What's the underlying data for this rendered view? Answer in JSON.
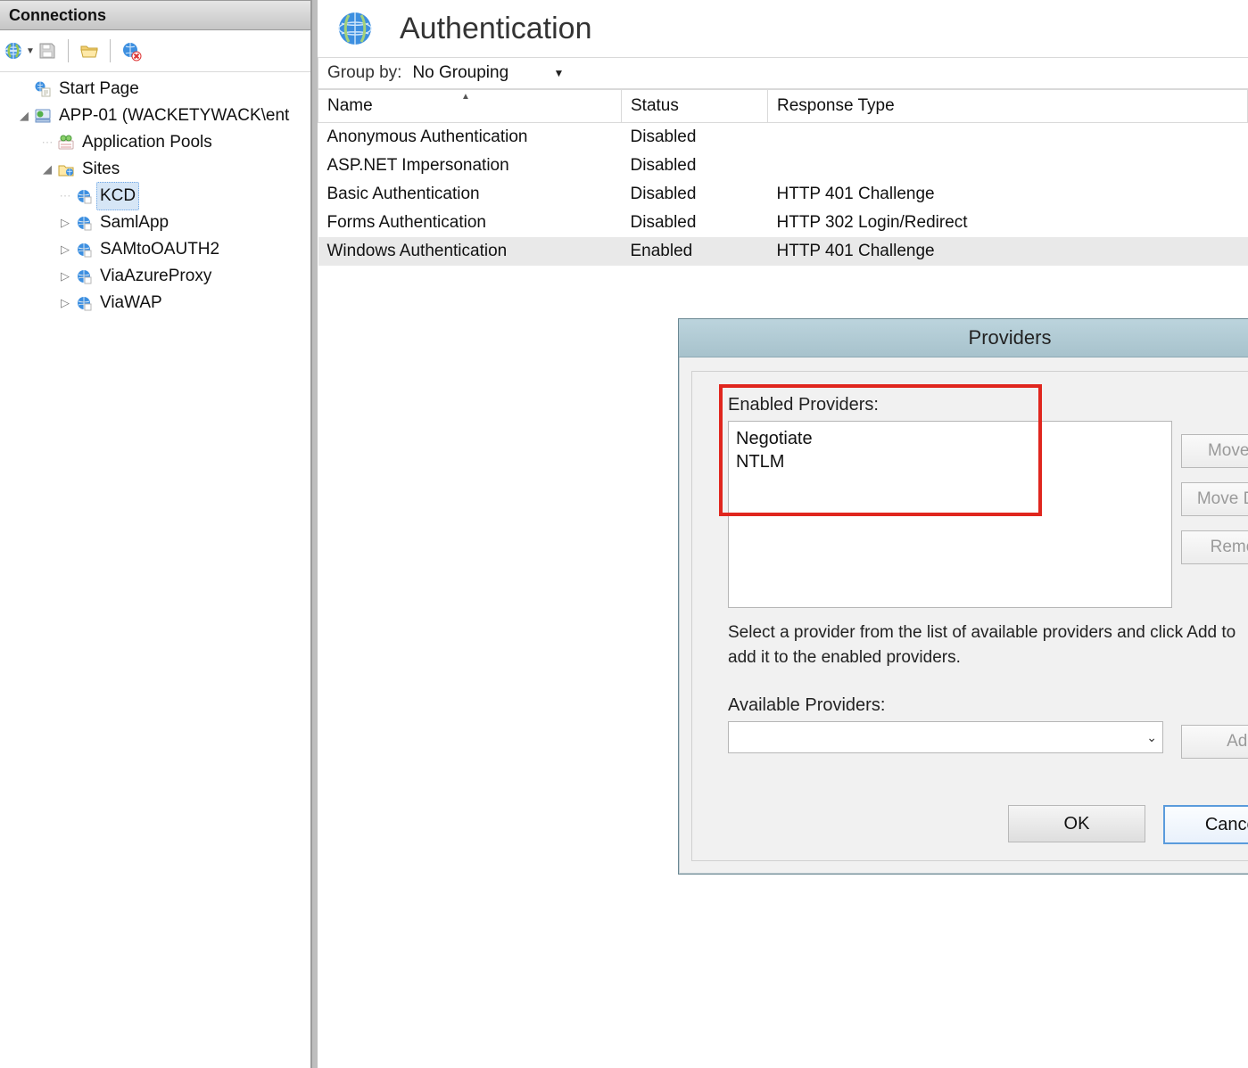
{
  "sidebar": {
    "title": "Connections",
    "tree": {
      "start_page": "Start Page",
      "server": "APP-01 (WACKETYWACK\\ent",
      "app_pools": "Application Pools",
      "sites": "Sites",
      "site_items": [
        "KCD",
        "SamlApp",
        "SAMtoOAUTH2",
        "ViaAzureProxy",
        "ViaWAP"
      ],
      "selected_index": 0
    }
  },
  "page": {
    "title": "Authentication",
    "group_by_label": "Group by:",
    "group_by_value": "No Grouping",
    "columns": [
      "Name",
      "Status",
      "Response Type"
    ],
    "rows": [
      {
        "name": "Anonymous Authentication",
        "status": "Disabled",
        "response": ""
      },
      {
        "name": "ASP.NET Impersonation",
        "status": "Disabled",
        "response": ""
      },
      {
        "name": "Basic Authentication",
        "status": "Disabled",
        "response": "HTTP 401 Challenge"
      },
      {
        "name": "Forms Authentication",
        "status": "Disabled",
        "response": "HTTP 302 Login/Redirect"
      },
      {
        "name": "Windows Authentication",
        "status": "Enabled",
        "response": "HTTP 401 Challenge"
      }
    ],
    "selected_row": 4
  },
  "dialog": {
    "title": "Providers",
    "help_symbol": "?",
    "close_symbol": "x",
    "enabled_label": "Enabled Providers:",
    "enabled": [
      "Negotiate",
      "NTLM"
    ],
    "instruction": "Select a provider from the list of available providers and click Add to add it to the enabled providers.",
    "available_label": "Available Providers:",
    "available_value": "",
    "buttons": {
      "move_up": "Move Up",
      "move_down": "Move Down",
      "remove": "Remove",
      "add": "Add",
      "ok": "OK",
      "cancel": "Cancel"
    }
  }
}
